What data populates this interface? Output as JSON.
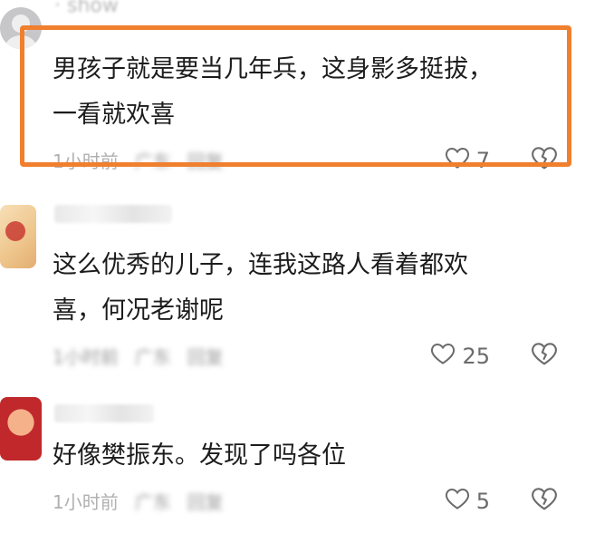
{
  "comments": [
    {
      "username": "· show",
      "text": "男孩子就是要当几年兵，这身影多挺拔，\n一看就欢喜",
      "time": "1小时前",
      "location": "广东",
      "reply": "回复",
      "likes": "7"
    },
    {
      "username": "",
      "text": "这么优秀的儿子，连我这路人看着都欢\n喜，何况老谢呢",
      "time": "1小时前",
      "location": "广东",
      "reply": "回复",
      "likes": "25"
    },
    {
      "username": "",
      "text": "好像樊振东。发现了吗各位",
      "time": "1小时前",
      "location": "广东",
      "reply": "回复",
      "likes": "5"
    }
  ],
  "highlight_color": "#f07f2e",
  "icons": {
    "like": "heart-outline-icon",
    "dislike": "broken-heart-icon"
  }
}
